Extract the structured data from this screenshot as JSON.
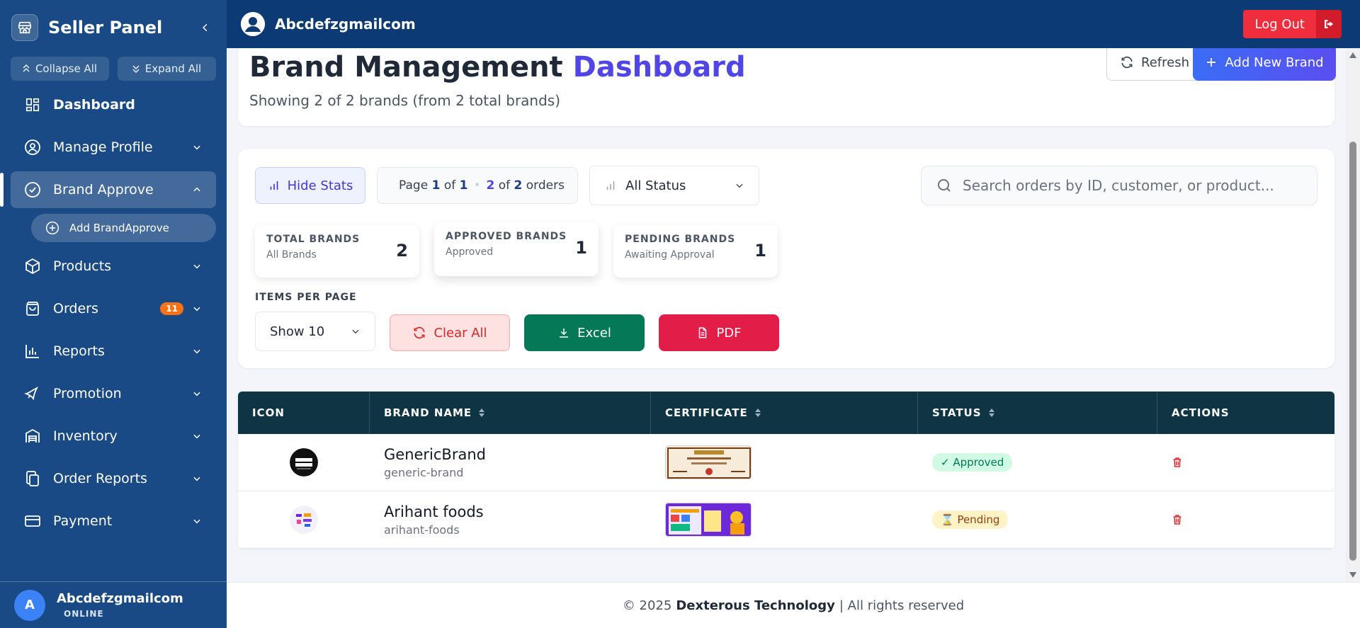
{
  "sidebar": {
    "title": "Seller Panel",
    "collapse_all": "Collapse All",
    "expand_all": "Expand All",
    "items": [
      {
        "label": "Dashboard"
      },
      {
        "label": "Manage Profile"
      },
      {
        "label": "Brand Approve"
      },
      {
        "label": "Products"
      },
      {
        "label": "Orders",
        "badge": "11"
      },
      {
        "label": "Reports"
      },
      {
        "label": "Promotion"
      },
      {
        "label": "Inventory"
      },
      {
        "label": "Order Reports"
      },
      {
        "label": "Payment"
      }
    ],
    "sub_item": "Add BrandApprove",
    "user": {
      "initial": "A",
      "name": "Abcdefzgmailcom",
      "status": "ONLINE"
    }
  },
  "topbar": {
    "user_name": "Abcdefzgmailcom",
    "logout_label": "Log Out"
  },
  "header": {
    "title_main": "Brand Management",
    "title_accent": "Dashboard",
    "subtitle": "Showing 2 of 2 brands (from 2 total brands)",
    "refresh_label": "Refresh",
    "add_label": "Add New Brand"
  },
  "filters": {
    "hide_stats": "Hide Stats",
    "page_word": "Page",
    "page_current": "1",
    "of_word": "of",
    "page_total": "1",
    "shown_count": "2",
    "total_count": "2",
    "orders_word": "orders",
    "status_value": "All Status",
    "search_placeholder": "Search orders by ID, customer, or product...",
    "items_per_page_label": "ITEMS PER PAGE",
    "items_per_page_value": "Show 10",
    "clear_label": "Clear All",
    "excel_label": "Excel",
    "pdf_label": "PDF"
  },
  "stats": [
    {
      "label": "TOTAL BRANDS",
      "sub": "All Brands",
      "value": "2"
    },
    {
      "label": "APPROVED BRANDS",
      "sub": "Approved",
      "value": "1"
    },
    {
      "label": "PENDING BRANDS",
      "sub": "Awaiting Approval",
      "value": "1"
    }
  ],
  "table": {
    "headers": [
      "ICON",
      "BRAND NAME",
      "CERTIFICATE",
      "STATUS",
      "ACTIONS"
    ],
    "rows": [
      {
        "name": "GenericBrand",
        "slug": "generic-brand",
        "status": "✓ Approved"
      },
      {
        "name": "Arihant foods",
        "slug": "arihant-foods",
        "status": "⌛ Pending"
      }
    ]
  },
  "footer": {
    "prefix": "© 2025",
    "company": "Dexterous Technology",
    "suffix": "| All rights reserved"
  },
  "colors": {
    "sidebar_bg": "#1a4a85",
    "topbar_bg": "#0c3a75",
    "accent": "#4f46e5",
    "table_header": "#0f3544",
    "logout": "#ef2d3c",
    "excel": "#047857",
    "pdf": "#e11d48"
  }
}
